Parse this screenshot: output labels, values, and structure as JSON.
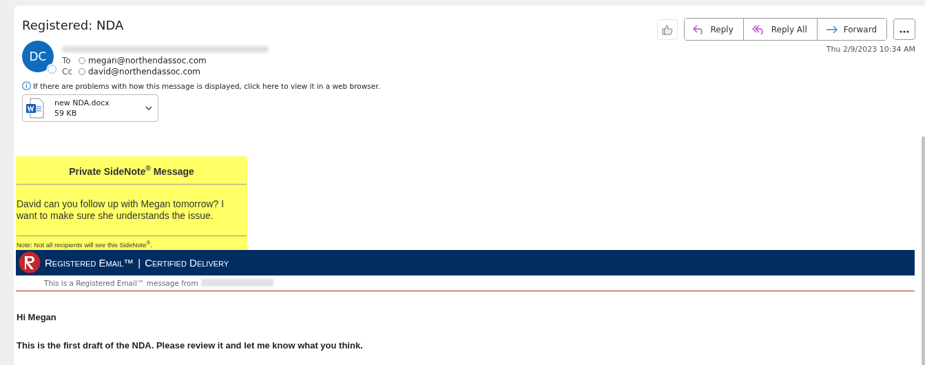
{
  "message": {
    "subject": "Registered: NDA",
    "avatar_initials": "DC",
    "to_label": "To",
    "to": "megan@northendassoc.com",
    "cc_label": "Cc",
    "cc": "david@northendassoc.com",
    "info": "If there are problems with how this message is displayed, click here to view it in a web browser.",
    "date": "Thu 2/9/2023 10:34 AM"
  },
  "actions": [
    {
      "kind": "reply",
      "label": "Reply"
    },
    {
      "kind": "reply_all",
      "label": "Reply All"
    },
    {
      "kind": "forward",
      "label": "Forward"
    }
  ],
  "attachment": {
    "name": "new NDA.docx",
    "size": "59 KB"
  },
  "sidenote": {
    "title": "Private SideNote$^{®}$ Message",
    "text": "David can you follow up with Megan tomorrow? I want to make sure she understands the issue.",
    "note": "Note: Not all recipients will see this SideNote$^{®}$."
  },
  "banner": {
    "brand": "Registered Email™",
    "separator": "|",
    "service": "Certified Delivery",
    "from_line": "This is a Registered Email™ message from"
  },
  "body": [
    "Hi Megan",
    "This is the first draft of the NDA. Please review it and let me know what you think."
  ]
}
